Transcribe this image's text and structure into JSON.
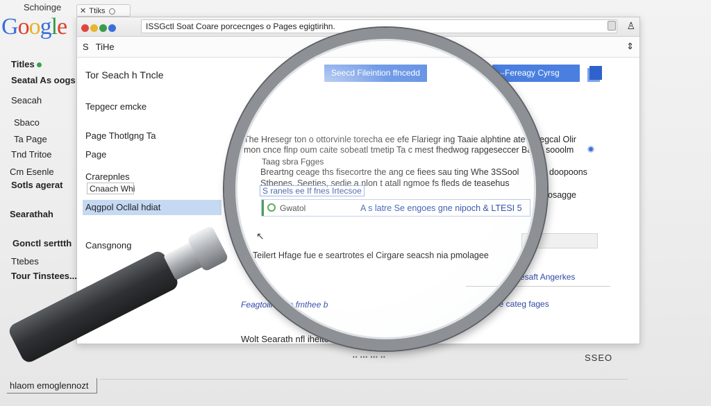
{
  "background": {
    "top_label": "Schoinge",
    "logo": [
      "G",
      "o",
      "o",
      "g",
      "l",
      "e"
    ],
    "tab_label": "Ttiks",
    "left_items": [
      {
        "label": "Titles",
        "dot": true,
        "bold": true
      },
      {
        "label": "Seatal As oogs",
        "bold": true
      },
      {
        "label": "Seacah"
      },
      {
        "label": "Sbaco"
      },
      {
        "label": "Ta Page"
      },
      {
        "label": "Tnd Tritoe"
      },
      {
        "label": "Cm Esenle"
      },
      {
        "label": "Sotls agerat",
        "bold": true
      },
      {
        "label": "Searathah",
        "bold": true
      },
      {
        "label": "Gonctl serttth",
        "bold": true
      },
      {
        "label": "Ttebes"
      },
      {
        "label": "Tour Tinstees...",
        "bold": true
      }
    ],
    "status_dots": "•• ••• ••• ••",
    "seo_label": "SSEO",
    "bottom_input_value": "hlaom emoglennozt"
  },
  "window": {
    "address_text": "ISSGctl Soat Coare porcecnges o Pages egigtirihn.",
    "section_title_prefix": "S",
    "section_title": "TiHe",
    "sidebar": {
      "heading": "Tor Seach h Tncle",
      "item1": "Tepgecr emcke",
      "item2": "Page Thotlgng Ta",
      "item3": "Page",
      "item4": "Crarepnles",
      "input_value": "Cnaach Whi",
      "selected": "Aqgpol Ocllal hdiat",
      "item5": "Cansgnong"
    },
    "buttons": {
      "primary": "Seecd Fileintion ffncedd",
      "secondary": "--Fereagy Cyrsg"
    },
    "content_lines": [
      "The Hresegr ton o ottorvinle torecha ee efe Flariegr ing Taaie alphtine ate",
      "mon cnce flnp oum caite sobeatl tmetip Ta c mest fhedwog rapgeseccer Ba"
    ],
    "side_words": [
      "Siegcal Olir",
      "sooolm"
    ],
    "inner_lines": [
      "Taag sbra Fgges",
      "Breartng ceage ths fisecortre the ang ce fiees sau ting Whe 3SSool",
      "Sthenes. Seeties, sedie a nlon t atall ngmoe fs fleds de teasehus"
    ],
    "right_words": [
      "doopoons",
      "osagge"
    ],
    "link_row": "S ranels ee If fnes Irtecsoe",
    "result_label": "Gwatol",
    "result_query": "A s latre Se engoes gne nipoch & LTESI 5",
    "lower_text": "Teilert Hfage fue e seartrotes el Cirgare seacsh nia pmolagee",
    "link_left": "Feagtoiin a fle fmthee b",
    "link_right": "le categ fages",
    "link_far": "Aesaft Angerkes",
    "bottom_text": "Wolt Searath nfl iheites"
  },
  "colors": {
    "accent_blue": "#4a7fe0",
    "selection": "#c5d9f3",
    "lens_metal": "#8d9196",
    "handle": "#3b3d40"
  }
}
